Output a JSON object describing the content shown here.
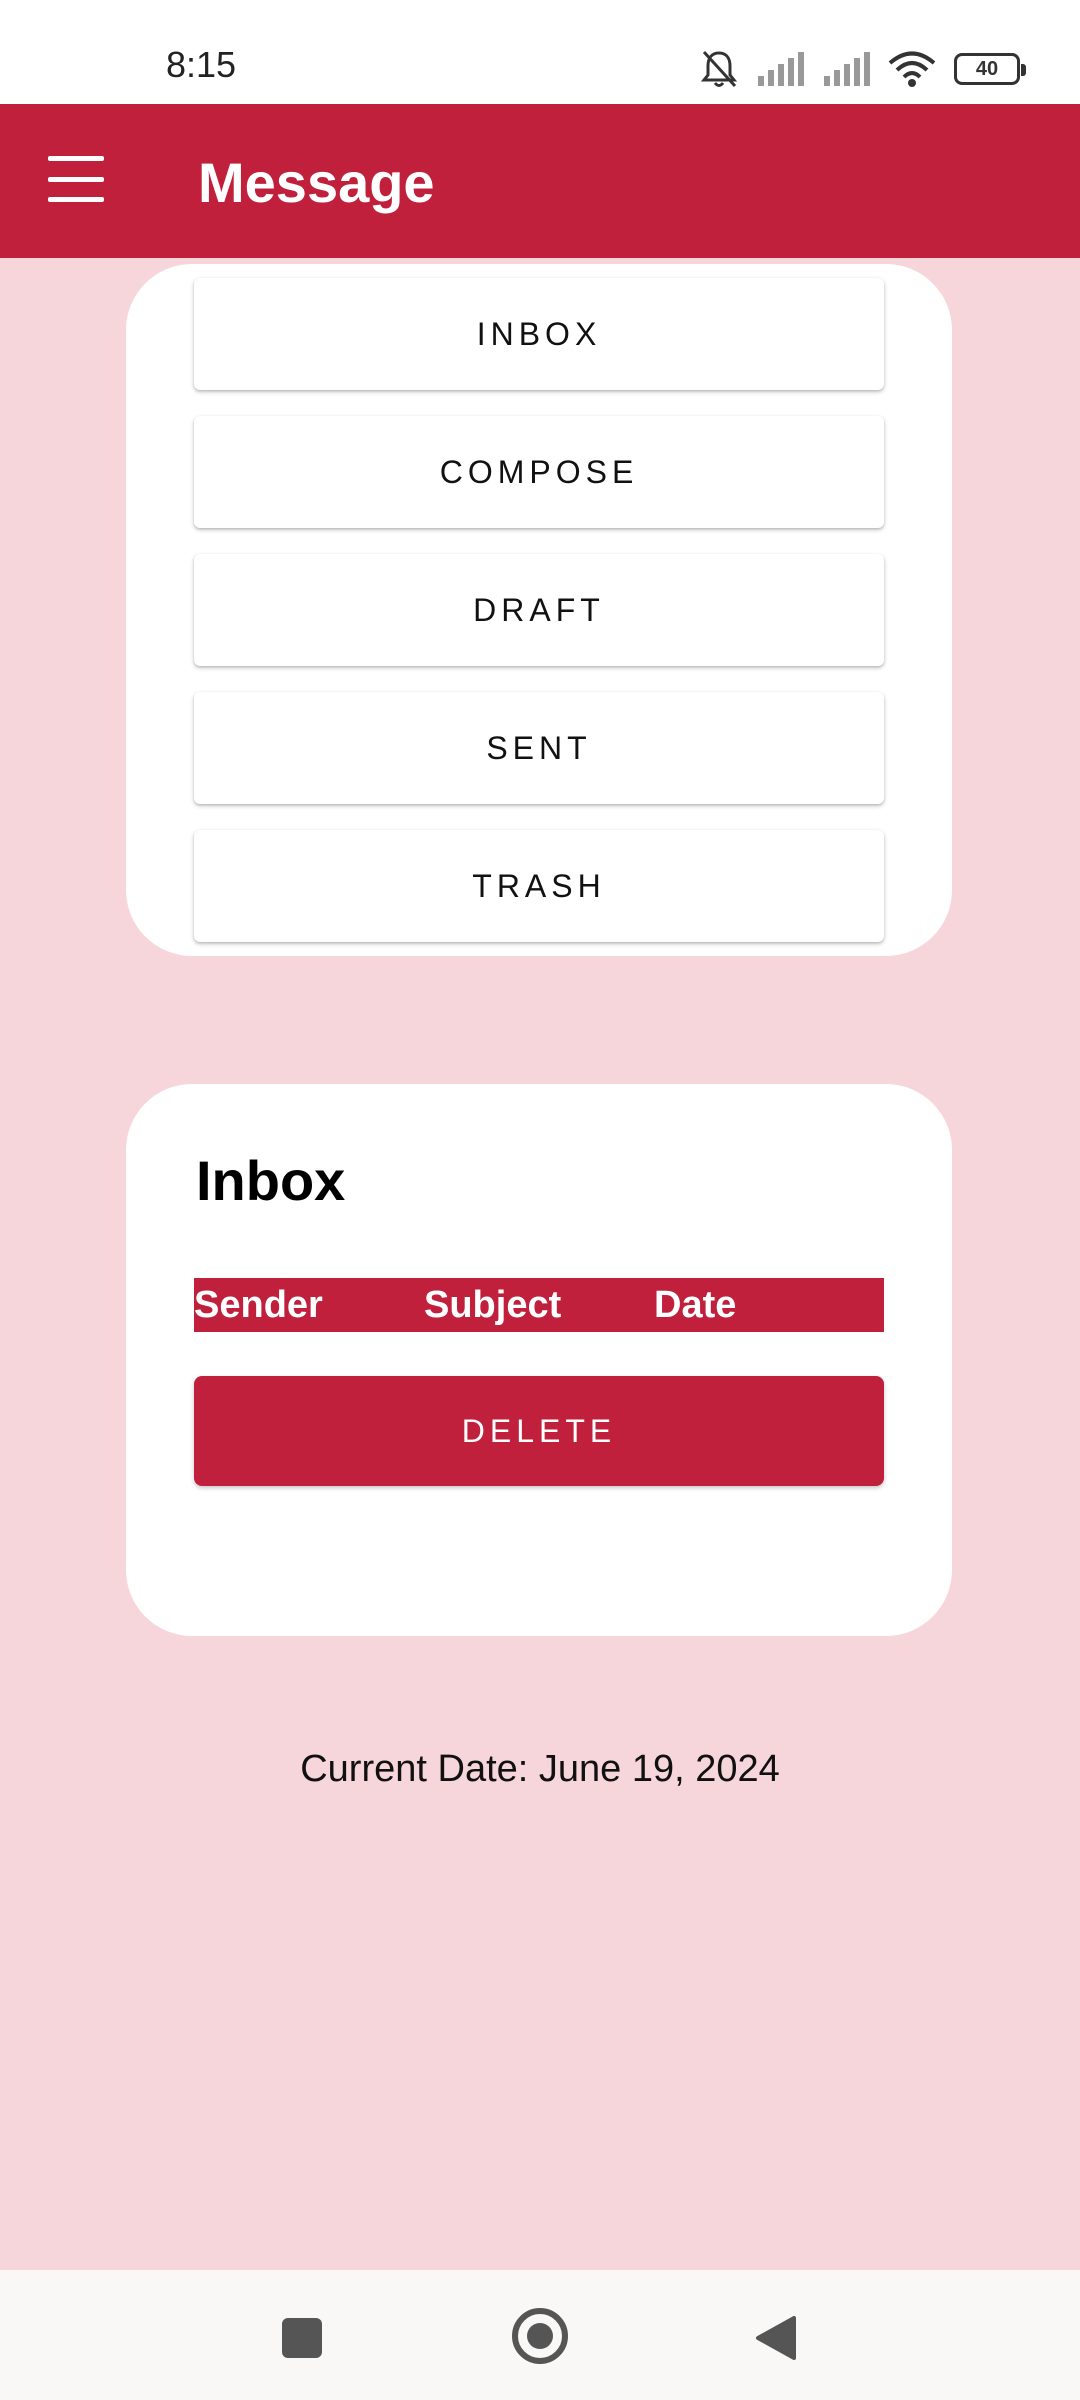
{
  "status_bar": {
    "time": "8:15",
    "battery_level": "40",
    "icons": [
      "bell-muted-icon",
      "signal-icon",
      "signal-icon",
      "wifi-icon",
      "battery-icon"
    ]
  },
  "app_bar": {
    "title": "Message",
    "menu_icon": "hamburger-menu-icon"
  },
  "nav_menu": {
    "items": [
      {
        "label": "INBOX"
      },
      {
        "label": "COMPOSE"
      },
      {
        "label": "DRAFT"
      },
      {
        "label": "SENT"
      },
      {
        "label": "TRASH"
      }
    ]
  },
  "inbox": {
    "title": "Inbox",
    "columns": [
      "Sender",
      "Subject",
      "Date"
    ],
    "rows": [],
    "delete_label": "DELETE"
  },
  "footer": {
    "current_date": "Current Date: June 19, 2024"
  },
  "colors": {
    "primary": "#c0203c",
    "background": "#f6d6db",
    "card": "#ffffff"
  },
  "system_nav": {
    "buttons": [
      "recents-icon",
      "home-icon",
      "back-icon"
    ]
  }
}
